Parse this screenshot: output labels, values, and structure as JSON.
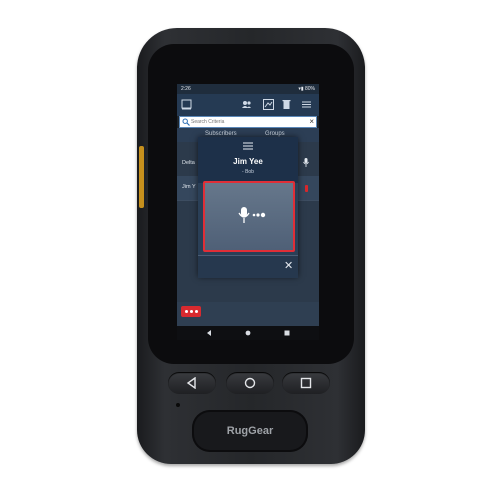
{
  "status_bar": {
    "time": "2:26",
    "battery": "▾▮ 80%"
  },
  "search": {
    "placeholder": "Search Criteria",
    "clear_icon": "×"
  },
  "tabs": [
    {
      "label": "Subscribers"
    },
    {
      "label": "Groups"
    }
  ],
  "list_rows": [
    {
      "label": "Delta"
    },
    {
      "label": "Jim Y"
    }
  ],
  "dialog": {
    "title": "Jim Yee",
    "subtitle": "- Bob",
    "close_icon": "✕"
  },
  "device": {
    "brand": "RugGear"
  },
  "colors": {
    "ptt_border": "#e02e37",
    "app_bar": "#253a53",
    "accent_red": "#d82a2f",
    "side_key": "#c6901d"
  },
  "icons": [
    "menu-icon",
    "people-icon",
    "map-icon",
    "trash-icon",
    "list-icon",
    "search-icon",
    "hamburger-icon",
    "mic-icon",
    "more-icon",
    "back-icon",
    "home-icon",
    "recents-icon"
  ]
}
